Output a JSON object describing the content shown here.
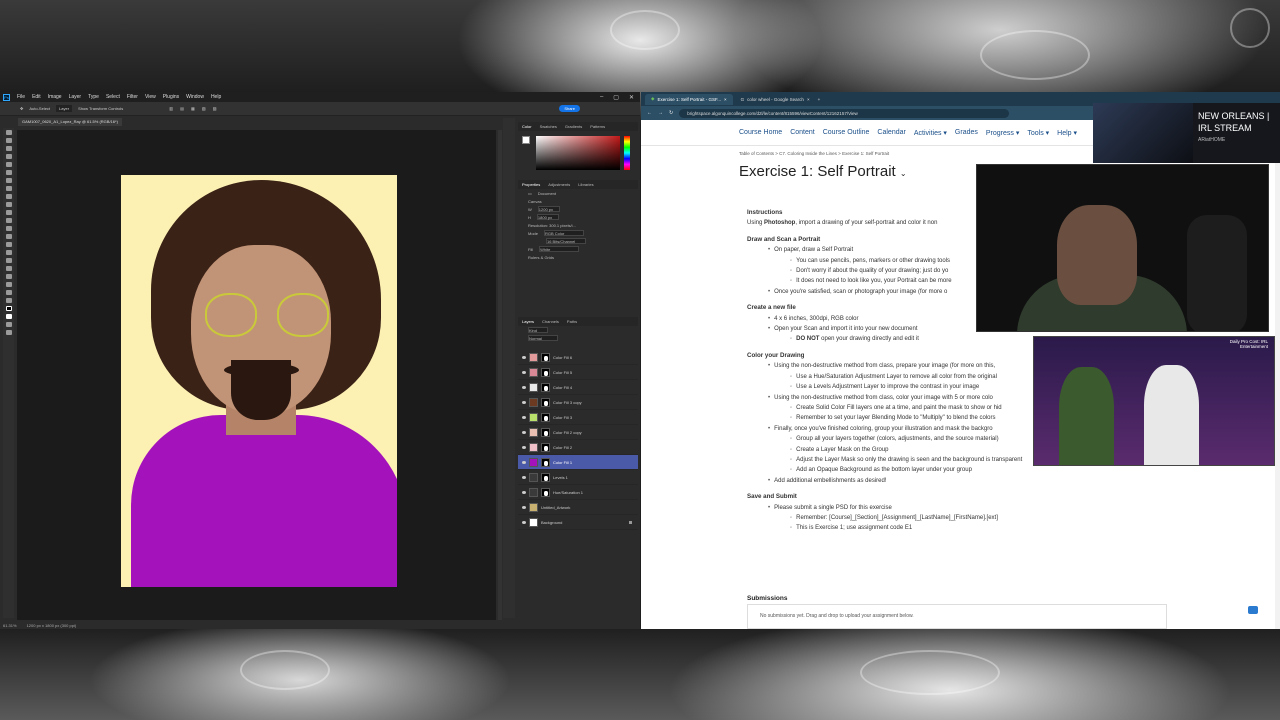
{
  "photoshop": {
    "menu": [
      "File",
      "Edit",
      "Image",
      "Layer",
      "Type",
      "Select",
      "Filter",
      "View",
      "Plugins",
      "Window",
      "Help"
    ],
    "options": [
      "Auto-Select",
      "Layer",
      "Show Transform Controls"
    ],
    "share_label": "Share",
    "doc_tab": "GAM1007_0620_A1_Lopez_Ray @ 61.5% (RGB/16*)",
    "status_zoom": "61.31%",
    "status_dims": "1200 px x 1800 px (300 ppi)",
    "panel_tabs": [
      "Color",
      "Swatches",
      "Gradients",
      "Patterns"
    ],
    "props_tabs": [
      "Properties",
      "Adjustments",
      "Libraries"
    ],
    "props_title": "Document",
    "canvas_label": "Canvas",
    "w_val": "1200 px",
    "h_val": "1800 px",
    "resolution": "Resolution: 300.1 pixels/i...",
    "mode_label": "Mode",
    "mode_val": "RGB Color",
    "bits_val": "16 Bits/Channel",
    "fill_label": "Fill",
    "fill_val": "White",
    "rulers_label": "Rulers & Grids",
    "layer_tabs": [
      "Layers",
      "Channels",
      "Paths"
    ],
    "layer_kind": "Kind",
    "layer_blend": "Normal",
    "layers": [
      {
        "name": "Color Fill 6",
        "color": "#e39a9a"
      },
      {
        "name": "Color Fill 5",
        "color": "#d98896"
      },
      {
        "name": "Color Fill 4",
        "color": "#e8e8e8"
      },
      {
        "name": "Color Fill 3 copy",
        "color": "#6b3a20"
      },
      {
        "name": "Color Fill 3",
        "color": "#b8e06a"
      },
      {
        "name": "Color Fill 2 copy",
        "color": "#e8bfb0"
      },
      {
        "name": "Color Fill 2",
        "color": "#f0c0c8"
      },
      {
        "name": "Color Fill 1",
        "color": "#a412bb"
      },
      {
        "name": "Levels 1",
        "color": "#3a3a3a"
      },
      {
        "name": "Hue/Saturation 1",
        "color": "#3a3a3a"
      },
      {
        "name": "Untitled_Artwork",
        "color": "#c8b070"
      },
      {
        "name": "Background",
        "color": "#ffffff"
      }
    ]
  },
  "browser": {
    "tabs": [
      "Exercise 1: Self Portrait - GSF...",
      "color wheel - Google Search"
    ],
    "url": "brightspace.algonquincollege.com/d2l/le/content/815596/viewContent/12162157/View",
    "nav": [
      "Course Home",
      "Content",
      "Course Outline",
      "Calendar",
      "Activities ▾",
      "Grades",
      "Progress ▾",
      "Tools ▾",
      "Help ▾"
    ],
    "breadcrumbs": "Table of Contents  >  C7. Coloring Inside the Lines  >  Exercise 1: Self Portrait",
    "title": "Exercise 1: Self Portrait",
    "instructions_h": "Instructions",
    "instructions_p_pre": "Using ",
    "instructions_p_bold": "Photoshop",
    "instructions_p_post": ", import a drawing of your self-portrait and color it non",
    "draw_h": "Draw and Scan a Portrait",
    "draw_items": [
      "On paper, draw a Self Portrait",
      "Once you're satisfied, scan or photograph your image (for more o"
    ],
    "draw_sub": [
      "You can use pencils, pens, markers or other drawing tools",
      "Don't worry if about the quality of your drawing; just do yo",
      "It does not need to look like you, your Portrait can be more"
    ],
    "newfile_h": "Create a new file",
    "newfile_items": [
      "4 x 6 inches, 300dpi, RGB color",
      "Open your Scan and import it into your new document"
    ],
    "newfile_sub_bold": "DO NOT",
    "newfile_sub_rest": " open your drawing directly and edit it",
    "color_h": "Color your Drawing",
    "color_items": [
      "Using the non-destructive method from class, prepare your image (for more on this,",
      "Using the non-destructive method from class, color your image with 5 or more colo",
      "Finally, once you've finished coloring, group your illustration and mask the backgro",
      "Add additional embellishments as desired!"
    ],
    "color_sub1": [
      "Use a Hue/Saturation Adjustment Layer to remove all color from the original",
      "Use a Levels Adjustment Layer to improve the contrast in your image"
    ],
    "color_sub2": [
      "Create Solid Color Fill layers one at a time, and paint the mask to show or hid",
      "Remember to set your layer Blending Mode to \"Multiply\" to blend the colors"
    ],
    "color_sub3": [
      "Group all your layers together (colors, adjustments, and the source material)",
      "Create a Layer Mask on the Group",
      "Adjust the Layer Mask so only the drawing is seen and the background is transparent",
      "Add an Opaque Background as the bottom layer under your group"
    ],
    "save_h": "Save and Submit",
    "save_items": [
      "Please submit a single PSD for this exercise"
    ],
    "save_sub": [
      "Remember: [Course]_[Section]_[Assignment]_[LastName]_[FirstName].[ext]",
      "This is Exercise 1; use assignment code E1"
    ],
    "submissions_h": "Submissions",
    "submissions_text": "No submissions yet. Drag and drop to upload your assignment below."
  },
  "overlay": {
    "banner_title": "NEW ORLEANS | IRL STREAM",
    "banner_sub": "ARiatHOME",
    "cam2_text": "Daily Pro Cost: IRL Entertainment"
  }
}
